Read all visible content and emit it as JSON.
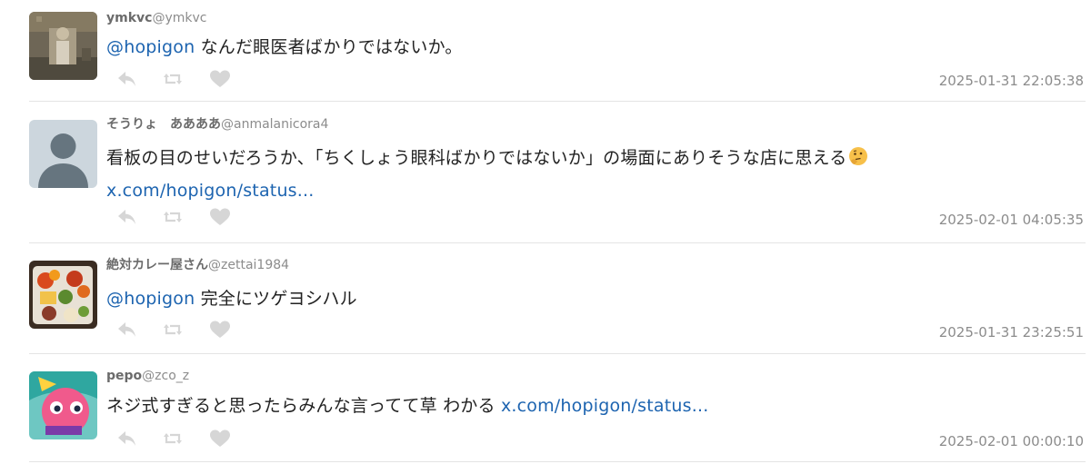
{
  "tweets": [
    {
      "name": "ymkvc",
      "handle": "@ymkvc",
      "mention": "@hopigon",
      "text": " なんだ眼医者ばかりではないか。",
      "timestamp": "2025-01-31 22:05:38",
      "avatar": "photo-avatar-icon"
    },
    {
      "name": "そうりょ　ああああ",
      "handle": "@anmalanicora4",
      "text": "看板の目のせいだろうか、「ちくしょう眼科ばかりではないか」の場面にありそうな店に思える",
      "emoji": "thinking-face-icon",
      "link": "x.com/hopigon/status...",
      "timestamp": "2025-02-01 04:05:35",
      "avatar": "default-avatar-icon"
    },
    {
      "name": "絶対カレー屋さん",
      "handle": "@zettai1984",
      "mention": "@hopigon",
      "text": " 完全にツゲヨシハル",
      "timestamp": "2025-01-31 23:25:51",
      "avatar": "food-avatar-icon"
    },
    {
      "name": "pepo",
      "handle": "@zco_z",
      "text": "ネジ式すぎると思ったらみんな言ってて草 わかる ",
      "link": "x.com/hopigon/status...",
      "timestamp": "2025-02-01 00:00:10",
      "avatar": "character-avatar-icon"
    }
  ],
  "actions": {
    "reply_icon": "reply-icon",
    "retweet_icon": "retweet-icon",
    "like_icon": "heart-icon"
  },
  "colors": {
    "link": "#1d64b0",
    "icon": "#d6d6d6",
    "meta": "#8c8c8c",
    "divider": "#e4e4e4"
  }
}
